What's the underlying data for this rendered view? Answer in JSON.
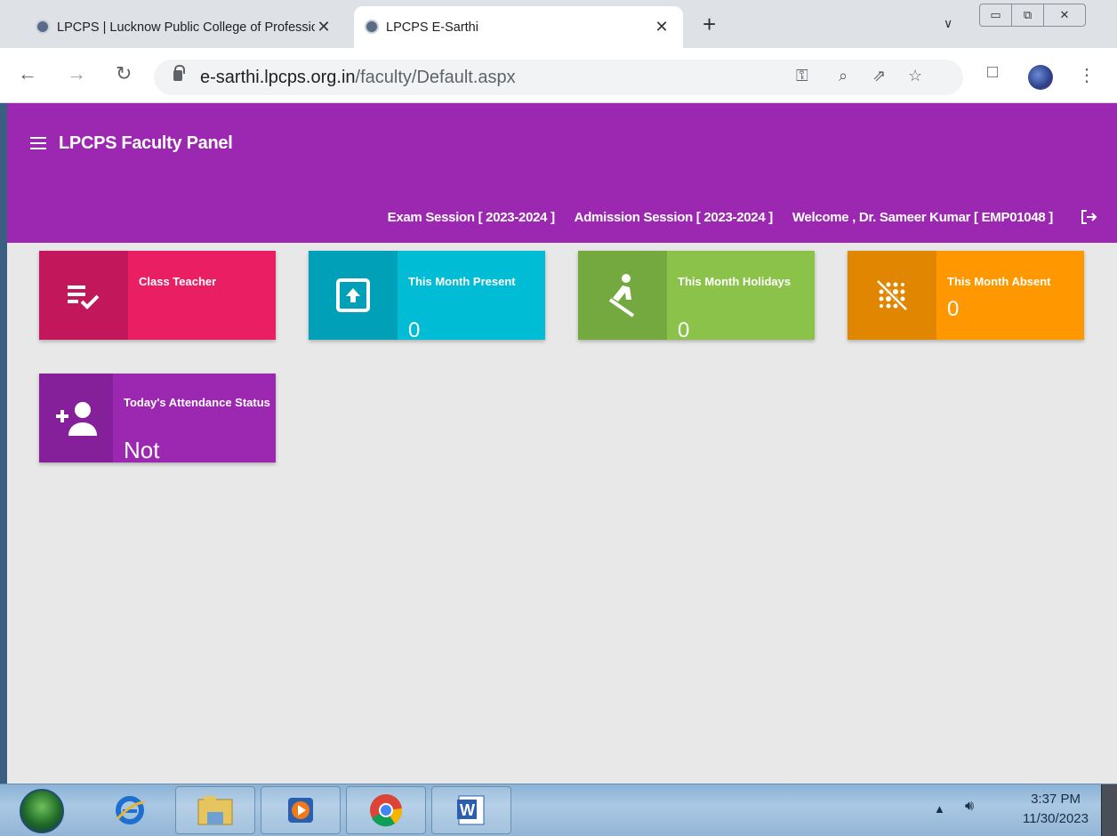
{
  "browser": {
    "tabs": [
      {
        "title": "LPCPS | Lucknow Public College of Professional Studies",
        "close": "✕",
        "active": false
      },
      {
        "title": "LPCPS E-Sarthi",
        "close": "✕",
        "active": true
      }
    ],
    "new_tab": "+",
    "url_host": "e-sarthi.lpcps.org.in",
    "url_path": "/faculty/Default.aspx"
  },
  "app": {
    "title": "LPCPS Faculty Panel",
    "exam_session": "Exam Session [ 2023-2024 ]",
    "admission_session": "Admission Session [ 2023-2024 ]",
    "welcome": "Welcome , Dr. Sameer Kumar [ EMP01048 ]"
  },
  "cards": [
    {
      "label": "Class Teacher",
      "value": "",
      "icon": "checklist-icon",
      "icon_bg": "#c2185b",
      "bg": "#e91e63"
    },
    {
      "label": "This Month Present",
      "value": "0",
      "icon": "upload-box-icon",
      "icon_bg": "#00a0b8",
      "bg": "#00bcd4"
    },
    {
      "label": "This Month Holidays",
      "value": "0",
      "icon": "rowing-icon",
      "icon_bg": "#74a940",
      "bg": "#8bc34a"
    },
    {
      "label": "This Month Absent",
      "value": "0",
      "icon": "blur-off-icon",
      "icon_bg": "#e08600",
      "bg": "#ff9800"
    },
    {
      "label": "Today's Attendance Status",
      "value": "Not",
      "icon": "person-add-icon",
      "icon_bg": "#86209a",
      "bg": "#9c27b0"
    }
  ],
  "taskbar": {
    "time": "3:37 PM",
    "date": "11/30/2023"
  }
}
